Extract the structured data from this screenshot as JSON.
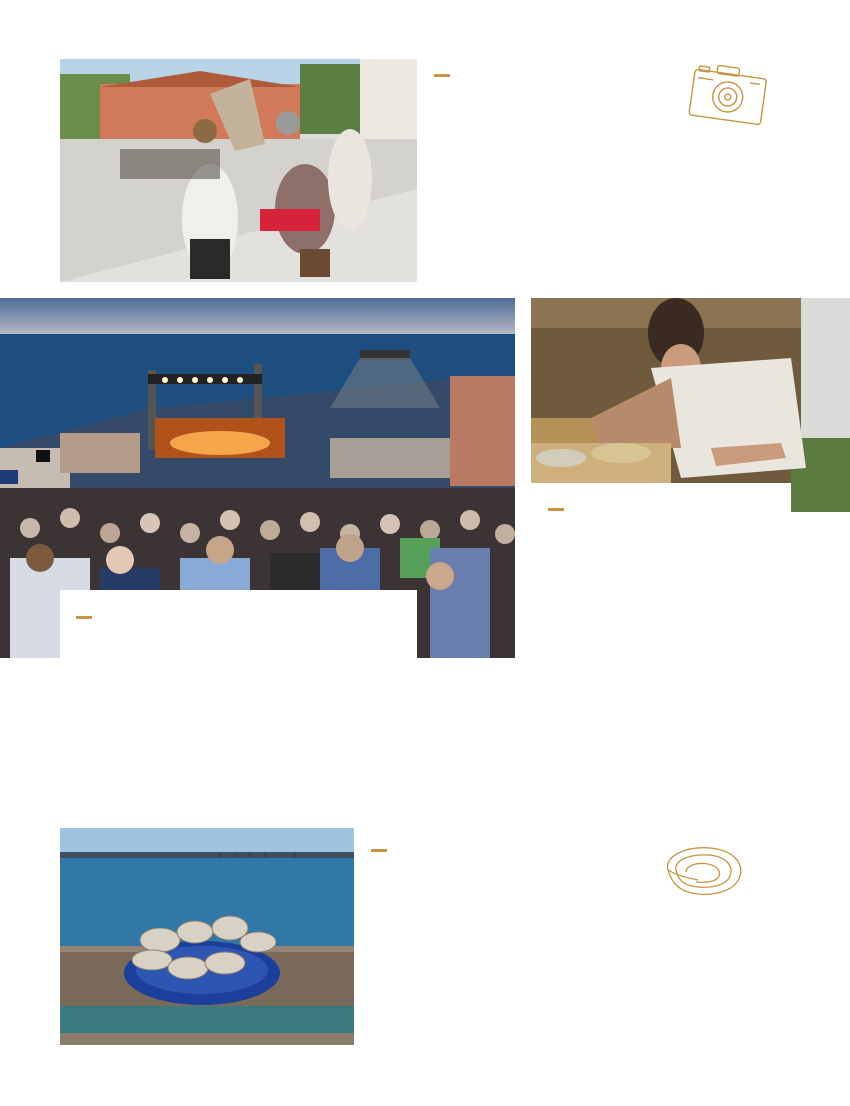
{
  "accent_color": "#c8943f",
  "photos": {
    "medieval": {
      "icon": "medieval-battle-photo",
      "caption": ""
    },
    "concert": {
      "icon": "seaside-concert-photo",
      "caption": ""
    },
    "artisan": {
      "icon": "artisan-craft-photo",
      "caption": ""
    },
    "oysters": {
      "icon": "oysters-plate-photo",
      "caption": ""
    }
  },
  "icons": {
    "camera": "camera-icon",
    "oyster": "oyster-icon"
  }
}
